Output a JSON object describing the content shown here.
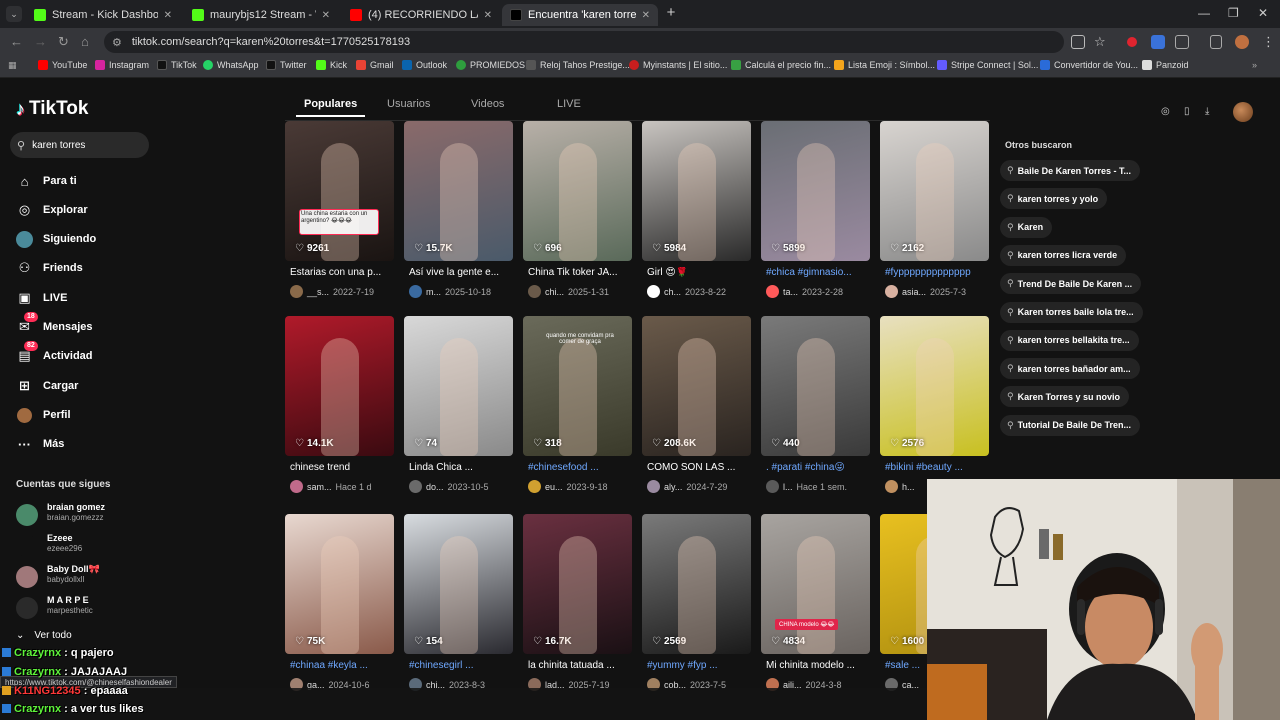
{
  "browser": {
    "tabs": [
      {
        "title": "Stream - Kick Dashboard",
        "color": "#53fc18"
      },
      {
        "title": "maurybjs12 Stream - Watch Live",
        "color": "#53fc18"
      },
      {
        "title": "(4) RECORRIENDO LA FERIA M",
        "color": "#ff0000"
      },
      {
        "title": "Encuentra 'karen torres' en TikT",
        "color": "#000000"
      }
    ],
    "url": "tiktok.com/search?q=karen%20torres&t=1770525178193",
    "bookmarks": [
      {
        "label": "YouTube",
        "color": "#ff0000"
      },
      {
        "label": "Instagram",
        "color": "#d6249f"
      },
      {
        "label": "TikTok",
        "color": "#111111"
      },
      {
        "label": "WhatsApp",
        "color": "#25d366"
      },
      {
        "label": "Twitter",
        "color": "#111111"
      },
      {
        "label": "Kick",
        "color": "#53fc18"
      },
      {
        "label": "Gmail",
        "color": "#ea4335"
      },
      {
        "label": "Outlook",
        "color": "#0a64ad"
      },
      {
        "label": "PROMIEDOS",
        "color": "#2e9e3e"
      },
      {
        "label": "Reloj Tahos Prestige...",
        "color": "#555555"
      },
      {
        "label": "Myinstants | El sitio...",
        "color": "#c81e1e"
      },
      {
        "label": "Calculá el precio fin...",
        "color": "#38a043"
      },
      {
        "label": "Lista Emoji : Símbol...",
        "color": "#f4a51c"
      },
      {
        "label": "Stripe Connect | Sol...",
        "color": "#635bff"
      },
      {
        "label": "Convertidor de You...",
        "color": "#2a6bd8"
      },
      {
        "label": "Panzoid",
        "color": "#dddddd"
      }
    ]
  },
  "tiktok": {
    "logo": "TikTok",
    "search_value": "karen torres",
    "nav": [
      {
        "label": "Para ti",
        "icon": "home-icon",
        "glyph": "⌂"
      },
      {
        "label": "Explorar",
        "icon": "compass-icon",
        "glyph": "◎"
      },
      {
        "label": "Siguiendo",
        "icon": "avatar-icon",
        "glyph": "●"
      },
      {
        "label": "Friends",
        "icon": "friends-icon",
        "glyph": "👥"
      },
      {
        "label": "LIVE",
        "icon": "live-icon",
        "glyph": "▣"
      },
      {
        "label": "Mensajes",
        "icon": "messages-icon",
        "glyph": "✉",
        "badge": "18"
      },
      {
        "label": "Actividad",
        "icon": "activity-icon",
        "glyph": "▤",
        "badge": "82"
      },
      {
        "label": "Cargar",
        "icon": "upload-icon",
        "glyph": "⊞"
      },
      {
        "label": "Perfil",
        "icon": "profile-icon",
        "glyph": "●"
      },
      {
        "label": "Más",
        "icon": "more-icon",
        "glyph": "···"
      }
    ],
    "following_title": "Cuentas que sigues",
    "following": [
      {
        "name": "braian gomez",
        "user": "braian.gomezzz",
        "color": "#4a8a6a"
      },
      {
        "name": "Ezeee",
        "user": "ezeee296",
        "color": "#121212"
      },
      {
        "name": "Baby Doll🎀",
        "user": "babydollxll",
        "color": "#a0787a"
      },
      {
        "name": "M A R P E",
        "user": "marpesthetic",
        "color": "#2a2a2a"
      }
    ],
    "see_all": "Ver todo",
    "tabs": [
      "Populares",
      "Usuarios",
      "Videos",
      "LIVE"
    ],
    "results": [
      {
        "likes": "9261",
        "caption": "Estarias con una p...",
        "user": "__s...",
        "date": "2022-7-19",
        "blue": false,
        "c1": "#4a3a36",
        "c2": "#1a1412",
        "av": "#8a6a4a"
      },
      {
        "likes": "15.7K",
        "caption": "Así vive la gente e...",
        "user": "m...",
        "date": "2025-10-18",
        "blue": false,
        "c1": "#8a6a6a",
        "c2": "#4a5a6a",
        "av": "#3a6aa0"
      },
      {
        "likes": "696",
        "caption": "China Tik toker JA...",
        "user": "chi...",
        "date": "2025-1-31",
        "blue": false,
        "c1": "#b8b0a8",
        "c2": "#5a6a5a",
        "av": "#6a5a4a"
      },
      {
        "likes": "5984",
        "caption": "Girl 😍🌹",
        "user": "ch...",
        "date": "2023-8-22",
        "blue": false,
        "c1": "#c8c4c0",
        "c2": "#2a2a2a",
        "av": "#ffffff"
      },
      {
        "likes": "5899",
        "caption": "#chica #gimnasio...",
        "user": "ta...",
        "date": "2023-2-28",
        "blue": true,
        "c1": "#6a6e74",
        "c2": "#9a8aa0",
        "av": "#ff5a5a"
      },
      {
        "likes": "2162",
        "caption": "#fyppppppppppppp",
        "user": "asia...",
        "date": "2025-7-3",
        "blue": true,
        "c1": "#d8d4d0",
        "c2": "#8a8a8a",
        "av": "#d8b0a0"
      },
      {
        "likes": "14.1K",
        "caption": "chinese trend",
        "user": "sam...",
        "date": "Hace 1 d",
        "blue": false,
        "c1": "#b01a2a",
        "c2": "#3a0a10",
        "av": "#c06a8a"
      },
      {
        "likes": "74",
        "caption": "Linda Chica ...",
        "user": "do...",
        "date": "2023-10-5",
        "blue": false,
        "c1": "#d8d8d8",
        "c2": "#8a8a8a",
        "av": "#6a6a6a"
      },
      {
        "likes": "318",
        "caption": "#chinesefood ...",
        "user": "eu...",
        "date": "2023-9-18",
        "blue": true,
        "c1": "#6a6a5a",
        "c2": "#3a3a2a",
        "av": "#d0a030"
      },
      {
        "likes": "208.6K",
        "caption": "COMO SON LAS ...",
        "user": "aly...",
        "date": "2024-7-29",
        "blue": false,
        "c1": "#6a5a4a",
        "c2": "#2a2420",
        "av": "#9a8aa0"
      },
      {
        "likes": "440",
        "caption": ". #parati #china😜",
        "user": "l...",
        "date": "Hace 1 sem.",
        "blue": true,
        "c1": "#7a7a7a",
        "c2": "#3a3a3a",
        "av": "#5a5a5a"
      },
      {
        "likes": "2576",
        "caption": "#bikini #beauty ...",
        "user": "h...",
        "date": "",
        "blue": true,
        "c1": "#e8e0c0",
        "c2": "#c8c020",
        "av": "#c09060"
      },
      {
        "likes": "75K",
        "caption": "#chinaa #keyla ...",
        "user": "ga...",
        "date": "2024-10-6",
        "blue": true,
        "c1": "#e8d8d0",
        "c2": "#8a5a4a",
        "av": "#a08070"
      },
      {
        "likes": "154",
        "caption": "#chinesegirl ...",
        "user": "chi...",
        "date": "2023-8-3",
        "blue": true,
        "c1": "#d8dce0",
        "c2": "#2a2a30",
        "av": "#5a6a7a"
      },
      {
        "likes": "16.7K",
        "caption": "la chinita tatuada ...",
        "user": "lad...",
        "date": "2025-7-19",
        "blue": false,
        "c1": "#6a3040",
        "c2": "#1a1014",
        "av": "#8a6a5a"
      },
      {
        "likes": "2569",
        "caption": "#yummy #fyp ...",
        "user": "cob...",
        "date": "2023-7-5",
        "blue": true,
        "c1": "#7a7a7a",
        "c2": "#1a1a1a",
        "av": "#a08060"
      },
      {
        "likes": "4834",
        "caption": "Mi chinita modelo ...",
        "user": "aili...",
        "date": "2024-3-8",
        "blue": false,
        "c1": "#a8a4a0",
        "c2": "#6a6460",
        "av": "#c07050"
      },
      {
        "likes": "1600",
        "caption": "#sale ...",
        "user": "ca...",
        "date": "",
        "blue": true,
        "c1": "#e8c020",
        "c2": "#b09010",
        "av": "#6a6a6a"
      }
    ],
    "thumb_texts": {
      "r0": "Una china estaria con un argentino? 😂😂😂",
      "r8": "quando me convidam pra comer de graça",
      "r16": "CHINA modelo 😂😂"
    },
    "others_title": "Otros buscaron",
    "others": [
      "Baile De Karen Torres - T...",
      "karen torres y yolo",
      "Karen",
      "karen torres licra verde",
      "Trend De Baile De Karen ...",
      "Karen torres baile lola tre...",
      "karen torres bellakita tre...",
      "karen torres bañador am...",
      "Karen Torres y su novio",
      "Tutorial De Baile De Tren..."
    ]
  },
  "overlay": {
    "status_url": "https://www.tiktok.com/@chineselfashiondealer",
    "chat": [
      {
        "user": "Crazyrnx",
        "msg": " : q pajero",
        "red": false
      },
      {
        "user": "Crazyrnx",
        "msg": " : JAJAJAAJ",
        "red": false
      },
      {
        "user": "K11NG12345",
        "msg": " : epaaaa",
        "red": true
      },
      {
        "user": "Crazyrnx",
        "msg": " : a ver tus likes",
        "red": false
      }
    ]
  }
}
